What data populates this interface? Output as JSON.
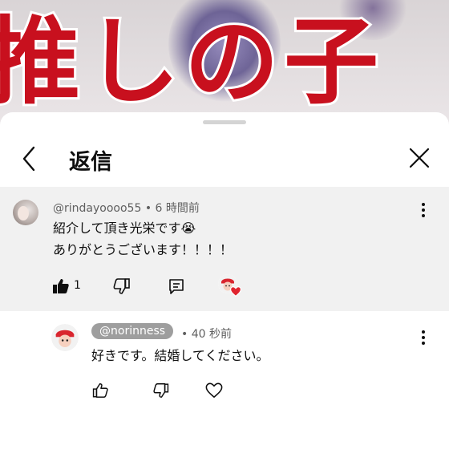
{
  "background": {
    "title_text": "推しの子"
  },
  "header": {
    "title": "返信"
  },
  "parent_comment": {
    "author": "@rindayoooo55",
    "separator": "•",
    "time": "6 時間前",
    "lines": [
      "紹介して頂き光栄です😭",
      "ありがとうございます！！！！"
    ],
    "like_count": "1"
  },
  "reply_comment": {
    "author": "@norinness",
    "separator": "•",
    "time": "40 秒前",
    "text": "好きです。結婚してください。"
  },
  "colors": {
    "accent_red": "#c8101e",
    "heart_red": "#e0242f",
    "chip_grey": "#9e9e9e"
  },
  "icons": [
    "chevron-left-icon",
    "close-icon",
    "more-vert-icon",
    "thumb-up-icon",
    "thumb-down-icon",
    "reply-icon",
    "heart-icon"
  ]
}
